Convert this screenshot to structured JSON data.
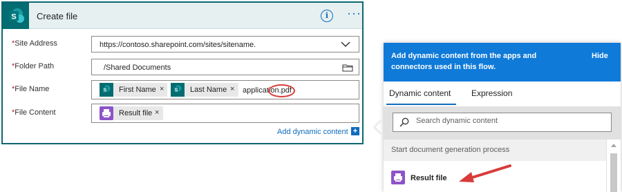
{
  "card": {
    "title": "Create file",
    "info_glyph": "i",
    "more_glyph": "···",
    "accent_color": "#036c70",
    "fields": {
      "site_address": {
        "label": "Site Address",
        "required": "*",
        "value": "https://contoso.sharepoint.com/sites/sitename."
      },
      "folder_path": {
        "label": "Folder Path",
        "required": "*",
        "value": "/Shared Documents"
      },
      "file_name": {
        "label": "File Name",
        "required": "*",
        "tokens": [
          {
            "label": "First Name",
            "icon": "sharepoint-icon"
          },
          {
            "label": "Last Name",
            "icon": "sharepoint-icon"
          }
        ],
        "suffix": "application.pdf"
      },
      "file_content": {
        "label": "File Content",
        "required": "*",
        "tokens": [
          {
            "label": "Result file",
            "icon": "document-generation-icon"
          }
        ]
      }
    },
    "remove_glyph": "×",
    "add_dynamic_content": "Add dynamic content",
    "add_icon_glyph": "+"
  },
  "panel": {
    "description": "Add dynamic content from the apps and connectors used in this flow.",
    "hide": "Hide",
    "header_color": "#0f7ad8",
    "tabs": [
      {
        "label": "Dynamic content",
        "selected": true
      },
      {
        "label": "Expression",
        "selected": false
      }
    ],
    "search": {
      "placeholder": "Search dynamic content",
      "value": ""
    },
    "section_title": "Start document generation process",
    "items": [
      {
        "label": "Result file",
        "icon": "document-generation-icon"
      }
    ]
  },
  "annotation": {
    "color": "#d83b3b"
  }
}
